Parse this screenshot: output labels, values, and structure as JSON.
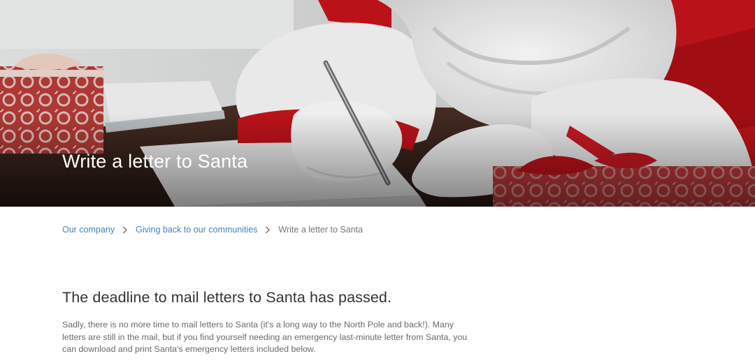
{
  "hero": {
    "title": "Write a letter to Santa",
    "image_label": "santa-writing-letter-photo"
  },
  "breadcrumb": {
    "items": [
      {
        "label": "Our company",
        "link": true
      },
      {
        "label": "Giving back to our communities",
        "link": true
      },
      {
        "label": "Write a letter to Santa",
        "link": false
      }
    ],
    "separator_icon": "chevron-right-icon"
  },
  "content": {
    "headline": "The deadline to mail letters to Santa has passed.",
    "body": "Sadly, there is no more time to mail letters to Santa (it's a long way to the North Pole and back!). Many letters are still in the mail, but if you find yourself needing an emergency last-minute letter from Santa, you can download and print Santa's emergency letters included below."
  },
  "colors": {
    "link": "#4a82b4",
    "heading": "#333333",
    "body_text": "#6a6a6a",
    "santa_red": "#c4131b"
  }
}
